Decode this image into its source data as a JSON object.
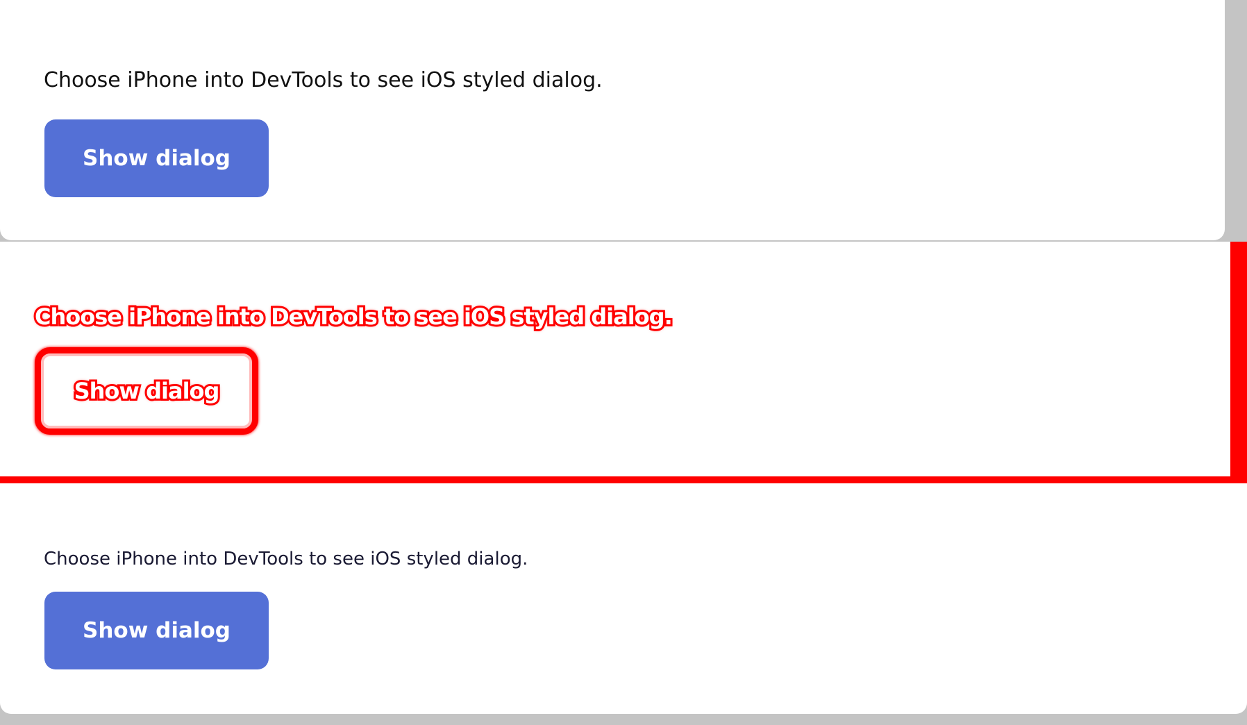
{
  "top": {
    "description": "Choose iPhone into DevTools to see iOS styled dialog.",
    "button_label": "Show dialog"
  },
  "diff": {
    "description": "Choose iPhone into DevTools to see iOS styled dialog.",
    "button_label": "Show dialog"
  },
  "bottom": {
    "description": "Choose iPhone into DevTools to see iOS styled dialog.",
    "button_label": "Show dialog"
  },
  "colors": {
    "background": "#c4c4c4",
    "panel": "#ffffff",
    "button": "#5470d6",
    "diff_highlight": "#ff0000"
  }
}
